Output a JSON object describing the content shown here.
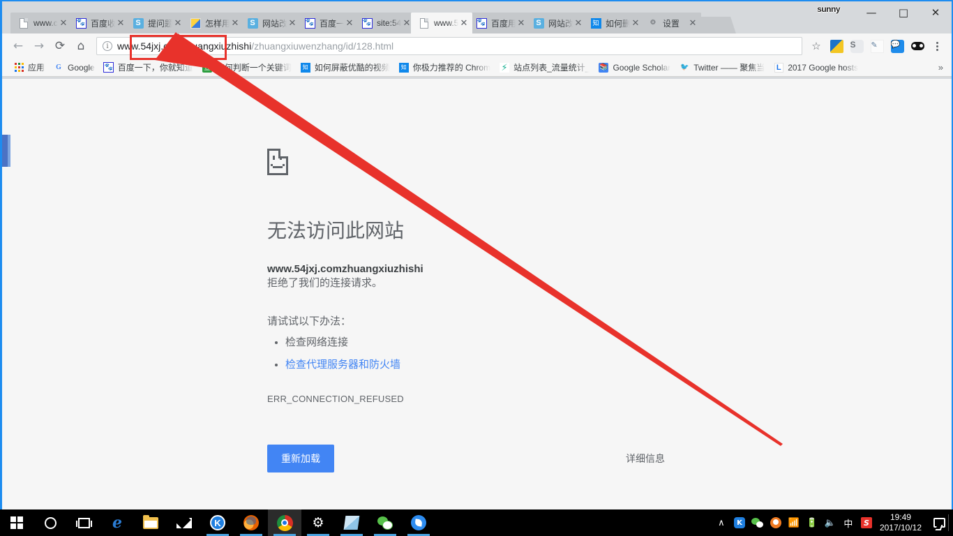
{
  "window": {
    "profile_name": "sunny",
    "controls": {
      "minimize": "—",
      "maximize": "□",
      "close": "✕"
    }
  },
  "tabs": [
    {
      "title": "www.c",
      "favicon": "document-icon",
      "active": false
    },
    {
      "title": "百度收",
      "favicon": "baidu-icon",
      "active": false
    },
    {
      "title": "提问题",
      "favicon": "sogou-icon",
      "active": false
    },
    {
      "title": "怎样用",
      "favicon": "color-icon",
      "active": false
    },
    {
      "title": "网站改",
      "favicon": "sogou-icon",
      "active": false
    },
    {
      "title": "百度一",
      "favicon": "baidu-icon",
      "active": false
    },
    {
      "title": "site:54",
      "favicon": "baidu-icon",
      "active": false
    },
    {
      "title": "www.5",
      "favicon": "document-icon",
      "active": true
    },
    {
      "title": "百度用",
      "favicon": "baidu-icon",
      "active": false
    },
    {
      "title": "网站改",
      "favicon": "sogou-icon",
      "active": false
    },
    {
      "title": "如何删",
      "favicon": "zhihu-icon",
      "active": false
    },
    {
      "title": "设置",
      "favicon": "gear-icon",
      "active": false
    }
  ],
  "toolbar": {
    "back": "←",
    "forward": "→",
    "reload": "⟳",
    "home": "⌂",
    "site_info_icon": "i",
    "url_prefix": "www.",
    "url_highlight": "54jxj.comzhuangxiuzhishi",
    "url_path": "/zhuangxiuwenzhang/id/128.html",
    "url_full": "www.54jxj.comzhuangxiuzhishi/zhuangxiuwenzhang/id/128.html",
    "bookmark_star": "☆",
    "extensions": [
      "app-blue-icon",
      "sogou-s-icon",
      "script-icon",
      "chat-bubble-icon",
      "panda-eyes-icon"
    ],
    "menu": "three-dot-menu-icon"
  },
  "bookmarks": {
    "items": [
      {
        "label": "应用",
        "icon": "apps-grid-icon"
      },
      {
        "label": "Google",
        "icon": "google-g-icon"
      },
      {
        "label": "百度一下，你就知道",
        "icon": "baidu-icon"
      },
      {
        "label": "如何判断一个关键词",
        "icon": "douban-icon"
      },
      {
        "label": "如何屏蔽优酷的视频",
        "icon": "zhihu-icon"
      },
      {
        "label": "你极力推荐的 Chrom",
        "icon": "zhihu-icon"
      },
      {
        "label": "站点列表_流量统计_",
        "icon": "51la-icon"
      },
      {
        "label": "Google Scholar",
        "icon": "google-scholar-icon"
      },
      {
        "label": "Twitter —— 聚焦当",
        "icon": "twitter-icon"
      },
      {
        "label": "2017 Google hosts",
        "icon": "hosts-icon"
      }
    ],
    "overflow": "»"
  },
  "error_page": {
    "icon": "sad-page-icon",
    "heading": "无法访问此网站",
    "summary_host": "www.54jxj.comzhuangxiuzhishi",
    "summary_rest": " 拒绝了我们的连接请求。",
    "suggestion_title": "请试试以下办法：",
    "suggestions": [
      "检查网络连接",
      "检查代理服务器和防火墙"
    ],
    "error_code": "ERR_CONNECTION_REFUSED",
    "reload_button": "重新加载",
    "details_button": "详细信息"
  },
  "annotation": {
    "color": "#e8322b",
    "shape": "rectangle-with-arrow",
    "target_text": "54jxj.comzhuangxiuzhishi"
  },
  "taskbar": {
    "items": [
      {
        "name": "start-button",
        "icon": "windows-logo-icon",
        "running": false,
        "active": false
      },
      {
        "name": "cortana-button",
        "icon": "cortana-circle-icon",
        "running": false,
        "active": false
      },
      {
        "name": "task-view-button",
        "icon": "task-view-icon",
        "running": false,
        "active": false
      },
      {
        "name": "edge-taskbar-item",
        "icon": "edge-icon",
        "running": false,
        "active": false
      },
      {
        "name": "explorer-taskbar-item",
        "icon": "folder-icon",
        "running": false,
        "active": false
      },
      {
        "name": "mail-taskbar-item",
        "icon": "mail-icon",
        "running": false,
        "active": false
      },
      {
        "name": "kingsoft-taskbar-item",
        "icon": "k-circle-icon",
        "running": true,
        "active": false
      },
      {
        "name": "firefox-taskbar-item",
        "icon": "firefox-icon",
        "running": true,
        "active": false
      },
      {
        "name": "chrome-taskbar-item",
        "icon": "chrome-icon",
        "running": true,
        "active": true
      },
      {
        "name": "settings-taskbar-item",
        "icon": "gear-icon",
        "running": true,
        "active": false
      },
      {
        "name": "notes-taskbar-item",
        "icon": "note-icon",
        "running": true,
        "active": false
      },
      {
        "name": "wechat-taskbar-item",
        "icon": "wechat-icon",
        "running": true,
        "active": false
      },
      {
        "name": "browser-taskbar-item",
        "icon": "blue-drop-icon",
        "running": true,
        "active": false
      }
    ],
    "tray": {
      "expand": "∧",
      "icons": [
        "kingsoft-tray-icon",
        "wechat-tray-icon",
        "thunder-tray-icon",
        "wifi-icon",
        "battery-icon",
        "volume-icon"
      ],
      "ime": "中",
      "sogou": "S",
      "time": "19:49",
      "date": "2017/10/12",
      "notification": "notification-icon"
    }
  }
}
